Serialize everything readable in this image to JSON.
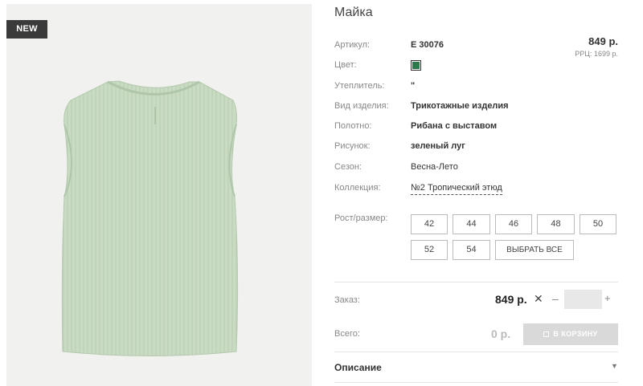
{
  "product": {
    "badge": "NEW",
    "title": "Майка",
    "price": "849 р.",
    "rrp": "РРЦ: 1699 р."
  },
  "specs": {
    "article_label": "Артикул:",
    "article_value": "Е 30076",
    "color_label": "Цвет:",
    "color_hex": "#2c7a4b",
    "insulation_label": "Утеплитель:",
    "insulation_value": "\"",
    "type_label": "Вид изделия:",
    "type_value": "Трикотажные изделия",
    "fabric_label": "Полотно:",
    "fabric_value": "Рибана с выставом",
    "pattern_label": "Рисунок:",
    "pattern_value": "зеленый луг",
    "season_label": "Сезон:",
    "season_value": "Весна-Лето",
    "collection_label": "Коллекция:",
    "collection_value": "№2 Тропический этюд"
  },
  "sizes": {
    "label": "Рост/размер:",
    "options": [
      "42",
      "44",
      "46",
      "48",
      "50",
      "52",
      "54"
    ],
    "select_all": "ВЫБРАТЬ ВСЕ"
  },
  "order": {
    "label": "Заказ:",
    "price": "849 р.",
    "times": "✕",
    "minus": "–",
    "plus": "+",
    "quantity": ""
  },
  "summary": {
    "total_label": "Всего:",
    "total_value": "0 р.",
    "cart_button": "В КОРЗИНУ"
  },
  "description": {
    "label": "Описание",
    "chevron": "▼"
  },
  "colors": {
    "photo_bg": "#f1f1f0",
    "garment": "#c9dcc3"
  }
}
